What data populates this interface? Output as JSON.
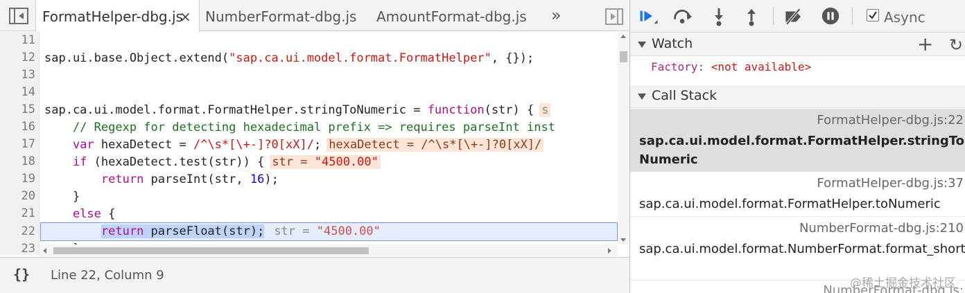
{
  "editor": {
    "tabs": [
      {
        "label": "FormatHelper-dbg.js",
        "active": true
      },
      {
        "label": "NumberFormat-dbg.js",
        "active": false
      },
      {
        "label": "AmountFormat-dbg.js",
        "active": false
      }
    ],
    "close_glyph": "×",
    "more_glyph": "»",
    "line_numbers": [
      "11",
      "12",
      "13",
      "14",
      "15",
      "16",
      "17",
      "18",
      "19",
      "20",
      "21",
      "22",
      "23"
    ],
    "lines": {
      "l12": {
        "a": "sap.ui.base.Object.extend(",
        "b": "\"sap.ca.ui.model.format.FormatHelper\"",
        "c": ", {});"
      },
      "l15": {
        "a": "sap.ca.ui.model.format.FormatHelper.stringToNumeric = ",
        "kw": "function",
        "b": "(str) {",
        "inline": "s"
      },
      "l16": {
        "comment": "// Regexp for detecting hexadecimal prefix => requires parseInt inst"
      },
      "l17": {
        "kw": "var",
        "a": " hexaDetect = ",
        "re": "/^\\s*[\\+-]?0[xX]/",
        "b": ";",
        "inline_key": "hexaDetect",
        "inline_eq": " = ",
        "inline_val": "/^\\s*[\\+-]?0[xX]/"
      },
      "l18": {
        "kw": "if",
        "a": " (hexaDetect.test(str)) {",
        "inline_key": "str",
        "inline_eq": " = ",
        "inline_val": "\"4500.00\""
      },
      "l19": {
        "kw": "return",
        "a": " parseInt(str, ",
        "num": "16",
        "b": ");"
      },
      "l20": {
        "a": "}"
      },
      "l21": {
        "kw": "else",
        "a": " {"
      },
      "l22": {
        "kw": "return",
        "a": " parseFloat(str);",
        "inline_key": "str",
        "inline_eq": " = ",
        "inline_val": "\"4500.00\""
      },
      "l23": {
        "a": "}"
      }
    },
    "pretty_print": "{}",
    "status": "Line 22, Column 9"
  },
  "debugger": {
    "async_label": "Async",
    "async_checked": true,
    "watch": {
      "title": "Watch",
      "add_glyph": "+",
      "refresh_glyph": "↻",
      "expr_name": "Factory",
      "expr_sep": ": ",
      "expr_value": "<not available>"
    },
    "call_stack": {
      "title": "Call Stack",
      "frames": [
        {
          "function": "sap.ca.ui.model.format.FormatHelper.stringToNumeric",
          "location": "FormatHelper-dbg.js:22",
          "selected": true
        },
        {
          "function": "sap.ca.ui.model.format.FormatHelper.toNumeric",
          "location": "FormatHelper-dbg.js:37",
          "selected": false
        },
        {
          "function": "sap.ca.ui.model.format.NumberFormat.format_short",
          "location": "NumberFormat-dbg.js:210",
          "selected": false
        },
        {
          "function": "",
          "location": "NumberFormat-dbg.js:",
          "selected": false
        }
      ]
    }
  },
  "watermark": "@稀土掘金技术社区",
  "colors": {
    "string": "#c41a16",
    "keyword": "#aa0d91",
    "comment": "#236e25",
    "number": "#1c00cf",
    "exec_line_bg": "#e5ecfb",
    "inline_value_bg": "#fbe5d6",
    "debugger_accent": "#1a73e8"
  }
}
